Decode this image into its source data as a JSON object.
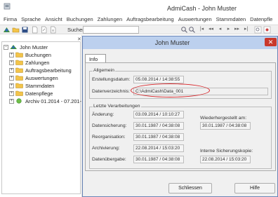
{
  "window": {
    "title": "AdmiCash - John Muster"
  },
  "menu": [
    "Firma",
    "Sprache",
    "Ansicht",
    "Buchungen",
    "Zahlungen",
    "Auftragsbearbeitung",
    "Auswertungen",
    "Stammdaten",
    "Datenpfle"
  ],
  "toolbar": {
    "search_label": "Suchen:",
    "search_value": ""
  },
  "tree": {
    "root": "John Muster",
    "items": [
      "Buchungen",
      "Zahlungen",
      "Auftragsbearbeitung",
      "Auswertungen",
      "Stammdaten",
      "Datenpflege",
      "Archiv 01.2014 - 07.201-"
    ]
  },
  "dialog": {
    "title": "John Muster",
    "close_glyph": "✕",
    "tab": "Info",
    "allgemein": {
      "title": "Allgemein",
      "erstellungsdatum_label": "Erstellungsdatum:",
      "erstellungsdatum_value": "05.08.2014 / 14:38:55",
      "datenverzeichnis_label": "Datenverzeichnis:",
      "datenverzeichnis_value": "C:\\AdmiCash\\Data_001"
    },
    "verarbeitungen": {
      "title": "Letzte Verarbeitungen",
      "rows": [
        {
          "label": "Änderung:",
          "value": "03.09.2014 / 10:10:27"
        },
        {
          "label": "Datensicherung:",
          "value": "30.01.1987 / 04:38:08"
        },
        {
          "label": "Reorganisation:",
          "value": "30.01.1987 / 04:38:08"
        },
        {
          "label": "Archivierung:",
          "value": "22.08.2014 / 15:03:20"
        },
        {
          "label": "Datenübergabe:",
          "value": "30.01.1987 / 04:38:08"
        }
      ],
      "wiederhergestellt_label": "Wiederhergestellt am:",
      "wiederhergestellt_value": "30.01.1987 / 04:38:08",
      "interne_sicherung_label": "Interne Sicherungskopie:",
      "interne_sicherung_value": "22.08.2014 / 15:03:20"
    },
    "buttons": {
      "close": "Schliessen",
      "help": "Hilfe"
    }
  },
  "colors": {
    "dialog_title_bg": "#bcd0ee",
    "close_button": "#c9382b",
    "highlight_ellipse": "#d8262a",
    "folder_yellow": "#f3c44a"
  }
}
